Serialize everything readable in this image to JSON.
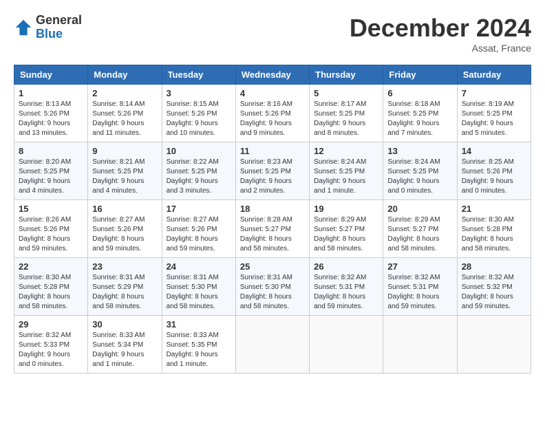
{
  "logo": {
    "general": "General",
    "blue": "Blue"
  },
  "title": "December 2024",
  "location": "Assat, France",
  "weekdays": [
    "Sunday",
    "Monday",
    "Tuesday",
    "Wednesday",
    "Thursday",
    "Friday",
    "Saturday"
  ],
  "weeks": [
    [
      {
        "day": "1",
        "sunrise": "8:13 AM",
        "sunset": "5:26 PM",
        "daylight": "9 hours and 13 minutes."
      },
      {
        "day": "2",
        "sunrise": "8:14 AM",
        "sunset": "5:26 PM",
        "daylight": "9 hours and 11 minutes."
      },
      {
        "day": "3",
        "sunrise": "8:15 AM",
        "sunset": "5:26 PM",
        "daylight": "9 hours and 10 minutes."
      },
      {
        "day": "4",
        "sunrise": "8:16 AM",
        "sunset": "5:26 PM",
        "daylight": "9 hours and 9 minutes."
      },
      {
        "day": "5",
        "sunrise": "8:17 AM",
        "sunset": "5:25 PM",
        "daylight": "9 hours and 8 minutes."
      },
      {
        "day": "6",
        "sunrise": "8:18 AM",
        "sunset": "5:25 PM",
        "daylight": "9 hours and 7 minutes."
      },
      {
        "day": "7",
        "sunrise": "8:19 AM",
        "sunset": "5:25 PM",
        "daylight": "9 hours and 5 minutes."
      }
    ],
    [
      {
        "day": "8",
        "sunrise": "8:20 AM",
        "sunset": "5:25 PM",
        "daylight": "9 hours and 4 minutes."
      },
      {
        "day": "9",
        "sunrise": "8:21 AM",
        "sunset": "5:25 PM",
        "daylight": "9 hours and 4 minutes."
      },
      {
        "day": "10",
        "sunrise": "8:22 AM",
        "sunset": "5:25 PM",
        "daylight": "9 hours and 3 minutes."
      },
      {
        "day": "11",
        "sunrise": "8:23 AM",
        "sunset": "5:25 PM",
        "daylight": "9 hours and 2 minutes."
      },
      {
        "day": "12",
        "sunrise": "8:24 AM",
        "sunset": "5:25 PM",
        "daylight": "9 hours and 1 minute."
      },
      {
        "day": "13",
        "sunrise": "8:24 AM",
        "sunset": "5:25 PM",
        "daylight": "9 hours and 0 minutes."
      },
      {
        "day": "14",
        "sunrise": "8:25 AM",
        "sunset": "5:26 PM",
        "daylight": "9 hours and 0 minutes."
      }
    ],
    [
      {
        "day": "15",
        "sunrise": "8:26 AM",
        "sunset": "5:26 PM",
        "daylight": "8 hours and 59 minutes."
      },
      {
        "day": "16",
        "sunrise": "8:27 AM",
        "sunset": "5:26 PM",
        "daylight": "8 hours and 59 minutes."
      },
      {
        "day": "17",
        "sunrise": "8:27 AM",
        "sunset": "5:26 PM",
        "daylight": "8 hours and 59 minutes."
      },
      {
        "day": "18",
        "sunrise": "8:28 AM",
        "sunset": "5:27 PM",
        "daylight": "8 hours and 58 minutes."
      },
      {
        "day": "19",
        "sunrise": "8:29 AM",
        "sunset": "5:27 PM",
        "daylight": "8 hours and 58 minutes."
      },
      {
        "day": "20",
        "sunrise": "8:29 AM",
        "sunset": "5:27 PM",
        "daylight": "8 hours and 58 minutes."
      },
      {
        "day": "21",
        "sunrise": "8:30 AM",
        "sunset": "5:28 PM",
        "daylight": "8 hours and 58 minutes."
      }
    ],
    [
      {
        "day": "22",
        "sunrise": "8:30 AM",
        "sunset": "5:28 PM",
        "daylight": "8 hours and 58 minutes."
      },
      {
        "day": "23",
        "sunrise": "8:31 AM",
        "sunset": "5:29 PM",
        "daylight": "8 hours and 58 minutes."
      },
      {
        "day": "24",
        "sunrise": "8:31 AM",
        "sunset": "5:30 PM",
        "daylight": "8 hours and 58 minutes."
      },
      {
        "day": "25",
        "sunrise": "8:31 AM",
        "sunset": "5:30 PM",
        "daylight": "8 hours and 58 minutes."
      },
      {
        "day": "26",
        "sunrise": "8:32 AM",
        "sunset": "5:31 PM",
        "daylight": "8 hours and 59 minutes."
      },
      {
        "day": "27",
        "sunrise": "8:32 AM",
        "sunset": "5:31 PM",
        "daylight": "8 hours and 59 minutes."
      },
      {
        "day": "28",
        "sunrise": "8:32 AM",
        "sunset": "5:32 PM",
        "daylight": "8 hours and 59 minutes."
      }
    ],
    [
      {
        "day": "29",
        "sunrise": "8:32 AM",
        "sunset": "5:33 PM",
        "daylight": "9 hours and 0 minutes."
      },
      {
        "day": "30",
        "sunrise": "8:33 AM",
        "sunset": "5:34 PM",
        "daylight": "9 hours and 1 minute."
      },
      {
        "day": "31",
        "sunrise": "8:33 AM",
        "sunset": "5:35 PM",
        "daylight": "9 hours and 1 minute."
      },
      null,
      null,
      null,
      null
    ]
  ]
}
